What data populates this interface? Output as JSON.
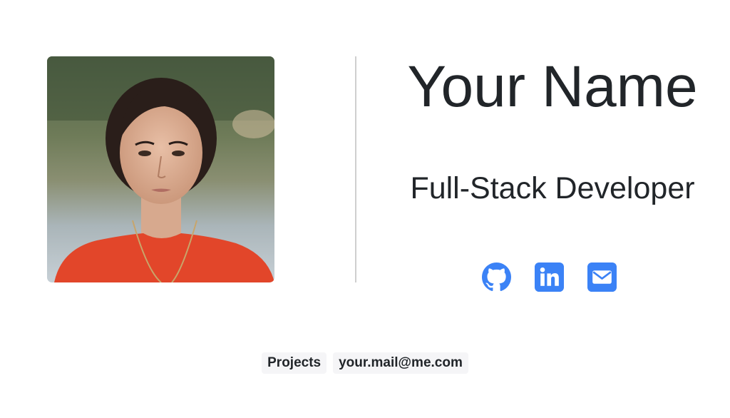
{
  "profile": {
    "name": "Your Name",
    "role": "Full-Stack Developer",
    "photo_alt": "profile photo"
  },
  "socials": [
    {
      "icon": "github-icon"
    },
    {
      "icon": "linkedin-icon"
    },
    {
      "icon": "mail-icon"
    }
  ],
  "footer": {
    "projects_label": "Projects",
    "email": "your.mail@me.com"
  },
  "colors": {
    "accent": "#3b82f6",
    "text": "#212529",
    "divider": "#cfcfcf",
    "pill_bg": "#f5f5f7"
  }
}
